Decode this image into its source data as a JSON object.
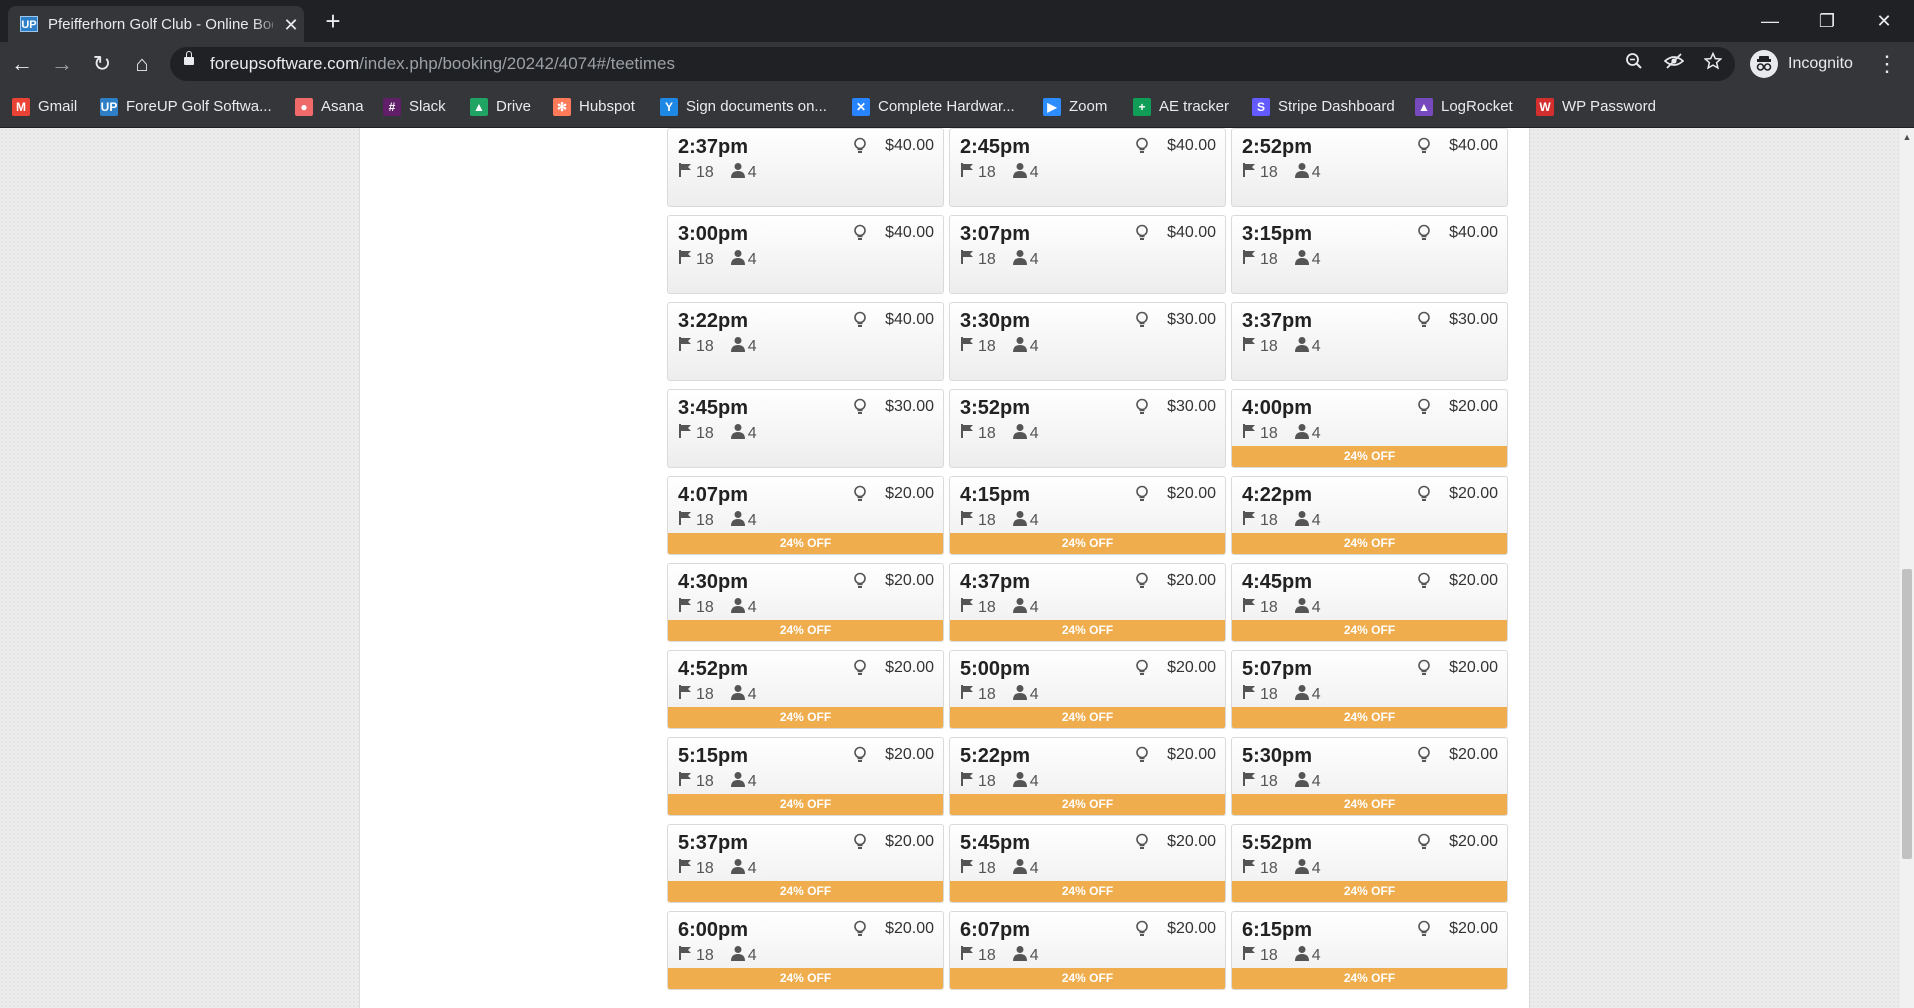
{
  "browser": {
    "tab": {
      "favicon_text": "UP",
      "title": "Pfeifferhorn Golf Club - Online Booking",
      "close": "✕"
    },
    "new_tab": "+",
    "window_controls": {
      "minimize": "—",
      "restore": "❐",
      "close": "✕"
    },
    "nav": {
      "back": "←",
      "forward": "→",
      "reload": "↻",
      "home": "⌂"
    },
    "url": {
      "host": "foreupsoftware.com",
      "path": "/index.php/booking/20242/4074#/teetimes"
    },
    "omnibox_icons": [
      "zoom-icon",
      "eye-off-icon",
      "star-icon"
    ],
    "profile": {
      "label": "Incognito"
    },
    "bookmarks": [
      {
        "label": "Gmail",
        "icon": "gmail-icon",
        "color": "#ea4335",
        "glyph": "M"
      },
      {
        "label": "ForeUP Golf Softwa...",
        "icon": "foreup-icon",
        "color": "#2f7fc6",
        "glyph": "UP"
      },
      {
        "label": "Asana",
        "icon": "asana-icon",
        "color": "#f06a6a",
        "glyph": "●"
      },
      {
        "label": "Slack",
        "icon": "slack-icon",
        "color": "#611f69",
        "glyph": "#"
      },
      {
        "label": "Drive",
        "icon": "drive-icon",
        "color": "#1fa463",
        "glyph": "▲"
      },
      {
        "label": "Hubspot",
        "icon": "hubspot-icon",
        "color": "#ff7a59",
        "glyph": "✻"
      },
      {
        "label": "Sign documents on...",
        "icon": "docusign-icon",
        "color": "#1e88e5",
        "glyph": "Y"
      },
      {
        "label": "Complete Hardwar...",
        "icon": "jira-icon",
        "color": "#2684ff",
        "glyph": "✕"
      },
      {
        "label": "Zoom",
        "icon": "zoom-app-icon",
        "color": "#2d8cff",
        "glyph": "▶"
      },
      {
        "label": "AE tracker",
        "icon": "sheets-icon",
        "color": "#0f9d58",
        "glyph": "+"
      },
      {
        "label": "Stripe Dashboard",
        "icon": "stripe-icon",
        "color": "#635bff",
        "glyph": "S"
      },
      {
        "label": "LogRocket",
        "icon": "logrocket-icon",
        "color": "#764abc",
        "glyph": "▲"
      },
      {
        "label": "WP Password",
        "icon": "wp-password-icon",
        "color": "#d32f2f",
        "glyph": "W"
      }
    ]
  },
  "colors": {
    "badge": "#f0ad4e",
    "page_bg": "#ececec"
  },
  "teetimes": [
    {
      "time": "2:37pm",
      "price": "$40.00",
      "holes": "18",
      "players": "4",
      "badge": ""
    },
    {
      "time": "2:45pm",
      "price": "$40.00",
      "holes": "18",
      "players": "4",
      "badge": ""
    },
    {
      "time": "2:52pm",
      "price": "$40.00",
      "holes": "18",
      "players": "4",
      "badge": ""
    },
    {
      "time": "3:00pm",
      "price": "$40.00",
      "holes": "18",
      "players": "4",
      "badge": ""
    },
    {
      "time": "3:07pm",
      "price": "$40.00",
      "holes": "18",
      "players": "4",
      "badge": ""
    },
    {
      "time": "3:15pm",
      "price": "$40.00",
      "holes": "18",
      "players": "4",
      "badge": ""
    },
    {
      "time": "3:22pm",
      "price": "$40.00",
      "holes": "18",
      "players": "4",
      "badge": ""
    },
    {
      "time": "3:30pm",
      "price": "$30.00",
      "holes": "18",
      "players": "4",
      "badge": ""
    },
    {
      "time": "3:37pm",
      "price": "$30.00",
      "holes": "18",
      "players": "4",
      "badge": ""
    },
    {
      "time": "3:45pm",
      "price": "$30.00",
      "holes": "18",
      "players": "4",
      "badge": ""
    },
    {
      "time": "3:52pm",
      "price": "$30.00",
      "holes": "18",
      "players": "4",
      "badge": ""
    },
    {
      "time": "4:00pm",
      "price": "$20.00",
      "holes": "18",
      "players": "4",
      "badge": "24% OFF"
    },
    {
      "time": "4:07pm",
      "price": "$20.00",
      "holes": "18",
      "players": "4",
      "badge": "24% OFF"
    },
    {
      "time": "4:15pm",
      "price": "$20.00",
      "holes": "18",
      "players": "4",
      "badge": "24% OFF"
    },
    {
      "time": "4:22pm",
      "price": "$20.00",
      "holes": "18",
      "players": "4",
      "badge": "24% OFF"
    },
    {
      "time": "4:30pm",
      "price": "$20.00",
      "holes": "18",
      "players": "4",
      "badge": "24% OFF"
    },
    {
      "time": "4:37pm",
      "price": "$20.00",
      "holes": "18",
      "players": "4",
      "badge": "24% OFF"
    },
    {
      "time": "4:45pm",
      "price": "$20.00",
      "holes": "18",
      "players": "4",
      "badge": "24% OFF"
    },
    {
      "time": "4:52pm",
      "price": "$20.00",
      "holes": "18",
      "players": "4",
      "badge": "24% OFF"
    },
    {
      "time": "5:00pm",
      "price": "$20.00",
      "holes": "18",
      "players": "4",
      "badge": "24% OFF"
    },
    {
      "time": "5:07pm",
      "price": "$20.00",
      "holes": "18",
      "players": "4",
      "badge": "24% OFF"
    },
    {
      "time": "5:15pm",
      "price": "$20.00",
      "holes": "18",
      "players": "4",
      "badge": "24% OFF"
    },
    {
      "time": "5:22pm",
      "price": "$20.00",
      "holes": "18",
      "players": "4",
      "badge": "24% OFF"
    },
    {
      "time": "5:30pm",
      "price": "$20.00",
      "holes": "18",
      "players": "4",
      "badge": "24% OFF"
    },
    {
      "time": "5:37pm",
      "price": "$20.00",
      "holes": "18",
      "players": "4",
      "badge": "24% OFF"
    },
    {
      "time": "5:45pm",
      "price": "$20.00",
      "holes": "18",
      "players": "4",
      "badge": "24% OFF"
    },
    {
      "time": "5:52pm",
      "price": "$20.00",
      "holes": "18",
      "players": "4",
      "badge": "24% OFF"
    },
    {
      "time": "6:00pm",
      "price": "$20.00",
      "holes": "18",
      "players": "4",
      "badge": "24% OFF"
    },
    {
      "time": "6:07pm",
      "price": "$20.00",
      "holes": "18",
      "players": "4",
      "badge": "24% OFF"
    },
    {
      "time": "6:15pm",
      "price": "$20.00",
      "holes": "18",
      "players": "4",
      "badge": "24% OFF"
    }
  ]
}
